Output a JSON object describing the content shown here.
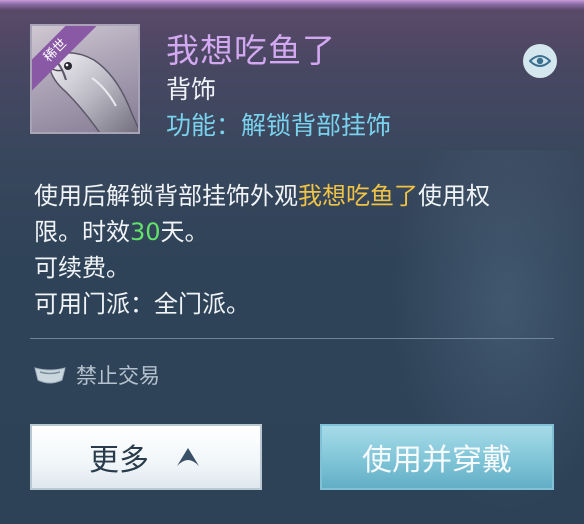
{
  "item": {
    "badge": "稀世",
    "name": "我想吃鱼了",
    "type": "背饰",
    "function": "功能：解锁背部挂饰"
  },
  "description": {
    "line1_prefix": "使用后解锁背部挂饰外观",
    "line1_highlight": "我想吃鱼了",
    "line1_suffix": "使用权",
    "line2_prefix": "限。时效",
    "line2_number": "30",
    "line2_suffix": "天。",
    "line3": "可续费。",
    "line4": "可用门派：全门派。"
  },
  "trade_status": "禁止交易",
  "buttons": {
    "more": "更多",
    "use_and_wear": "使用并穿戴"
  },
  "colors": {
    "title": "#d2a8f0",
    "function": "#79d3ee",
    "highlight": "#f0c245",
    "number": "#62e26a"
  },
  "icons": [
    "fish-item-icon",
    "eye-icon",
    "no-trade-icon",
    "arrow-up-icon"
  ]
}
